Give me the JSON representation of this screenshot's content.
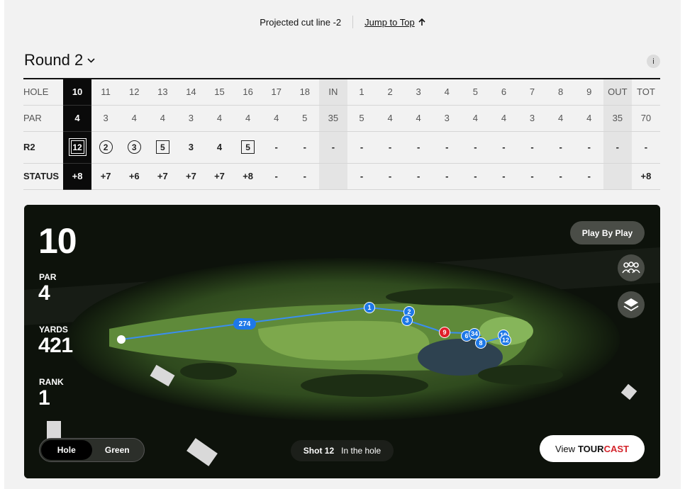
{
  "topbar": {
    "projected_cut": "Projected cut line -2",
    "jump_to_top": "Jump to Top"
  },
  "round": {
    "title": "Round 2",
    "info_icon": "i"
  },
  "scorecard": {
    "labels": {
      "hole": "HOLE",
      "par": "PAR",
      "round": "R2",
      "status": "STATUS"
    },
    "holes": [
      "10",
      "11",
      "12",
      "13",
      "14",
      "15",
      "16",
      "17",
      "18",
      "IN",
      "1",
      "2",
      "3",
      "4",
      "5",
      "6",
      "7",
      "8",
      "9",
      "OUT",
      "TOT"
    ],
    "pars": [
      "4",
      "3",
      "4",
      "4",
      "3",
      "4",
      "4",
      "4",
      "5",
      "35",
      "5",
      "4",
      "4",
      "3",
      "4",
      "4",
      "3",
      "4",
      "4",
      "35",
      "70"
    ],
    "scores": [
      "12",
      "2",
      "3",
      "5",
      "3",
      "4",
      "5",
      "-",
      "-",
      "-",
      "-",
      "-",
      "-",
      "-",
      "-",
      "-",
      "-",
      "-",
      "-",
      "-",
      "-"
    ],
    "score_marks": [
      "double-square",
      "circle",
      "circle",
      "square",
      "none",
      "none",
      "square",
      "none",
      "none",
      "none",
      "none",
      "none",
      "none",
      "none",
      "none",
      "none",
      "none",
      "none",
      "none",
      "none",
      "none"
    ],
    "status": [
      "+8",
      "+7",
      "+6",
      "+7",
      "+7",
      "+7",
      "+8",
      "-",
      "-",
      "",
      "-",
      "-",
      "-",
      "-",
      "-",
      "-",
      "-",
      "-",
      "-",
      "",
      "+8"
    ],
    "current_hole_index": 0
  },
  "hole_info": {
    "number": "10",
    "par_label": "PAR",
    "par": "4",
    "yards_label": "YARDS",
    "yards": "421",
    "rank_label": "RANK",
    "rank": "1"
  },
  "map": {
    "distance_label": "274",
    "shot_markers": [
      "1",
      "2",
      "3",
      "9",
      "6",
      "34",
      "8",
      "10",
      "12"
    ],
    "highlight_color": "#e0202a",
    "marker_color": "#1e78e8",
    "line_color": "#3a8ef0"
  },
  "controls": {
    "play_by_play": "Play By Play",
    "group_icon": "group-icon",
    "layers_icon": "layers-icon",
    "view_hole": "Hole",
    "view_green": "Green",
    "shot_label": "Shot 12",
    "shot_status": "In the hole",
    "tourcast_view": "View",
    "tourcast_brand_a": "TOUR",
    "tourcast_brand_b": "CAST"
  }
}
